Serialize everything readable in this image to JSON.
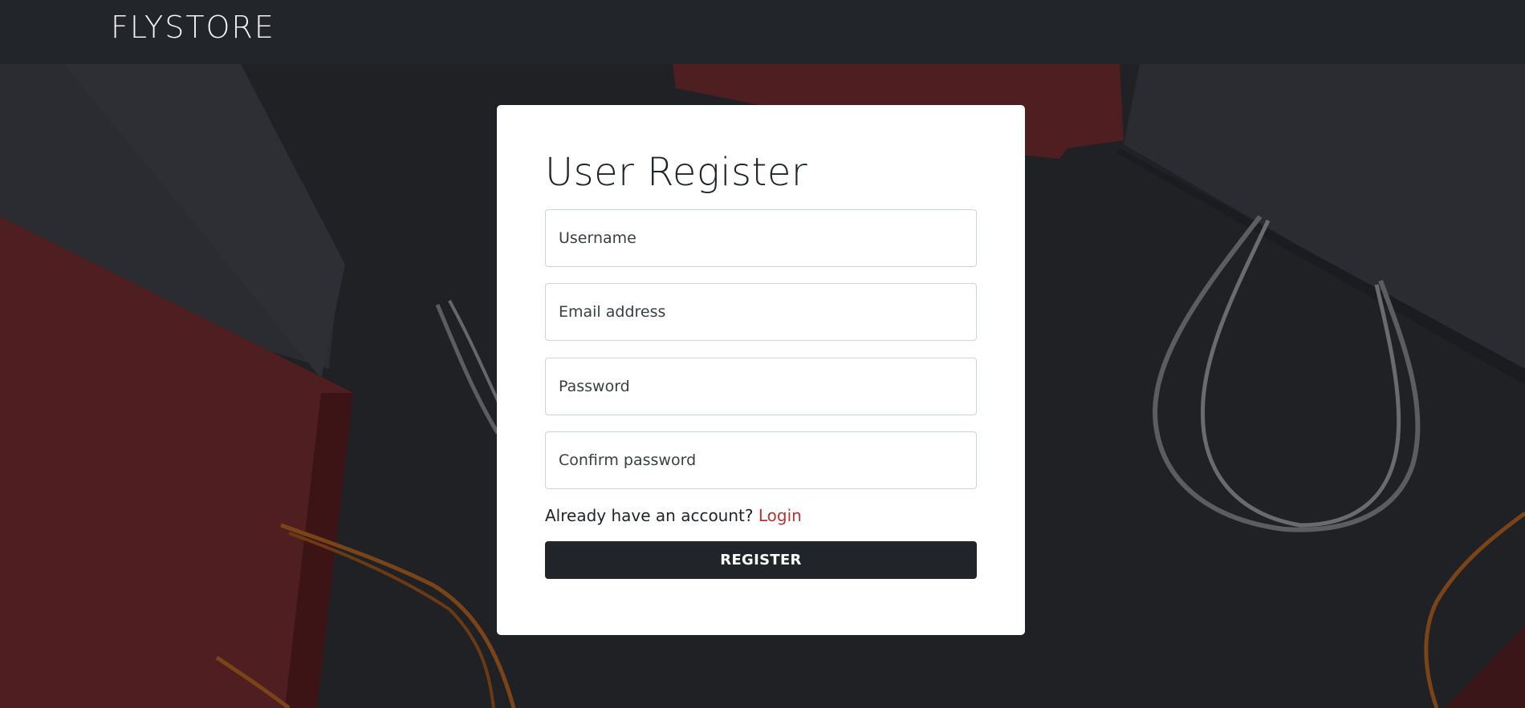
{
  "navbar": {
    "brand": "FLYSTORE"
  },
  "register_form": {
    "title": "User Register",
    "fields": [
      {
        "name": "username",
        "placeholder": "Username",
        "value": ""
      },
      {
        "name": "email",
        "placeholder": "Email address",
        "value": ""
      },
      {
        "name": "password",
        "placeholder": "Password",
        "value": ""
      },
      {
        "name": "confirm_password",
        "placeholder": "Confirm password",
        "value": ""
      }
    ],
    "account_prompt": "Already have an account?",
    "login_link": "Login",
    "submit_label": "REGISTER"
  },
  "colors": {
    "navbar": "#22252a",
    "background": "#1f2125",
    "card": "#ffffff",
    "button": "#212529",
    "link": "#b33434",
    "bag_red": "#5a1f21",
    "bag_black": "#2b2d31"
  },
  "background_image": {
    "description_icon": "shopping-bags-icon"
  }
}
